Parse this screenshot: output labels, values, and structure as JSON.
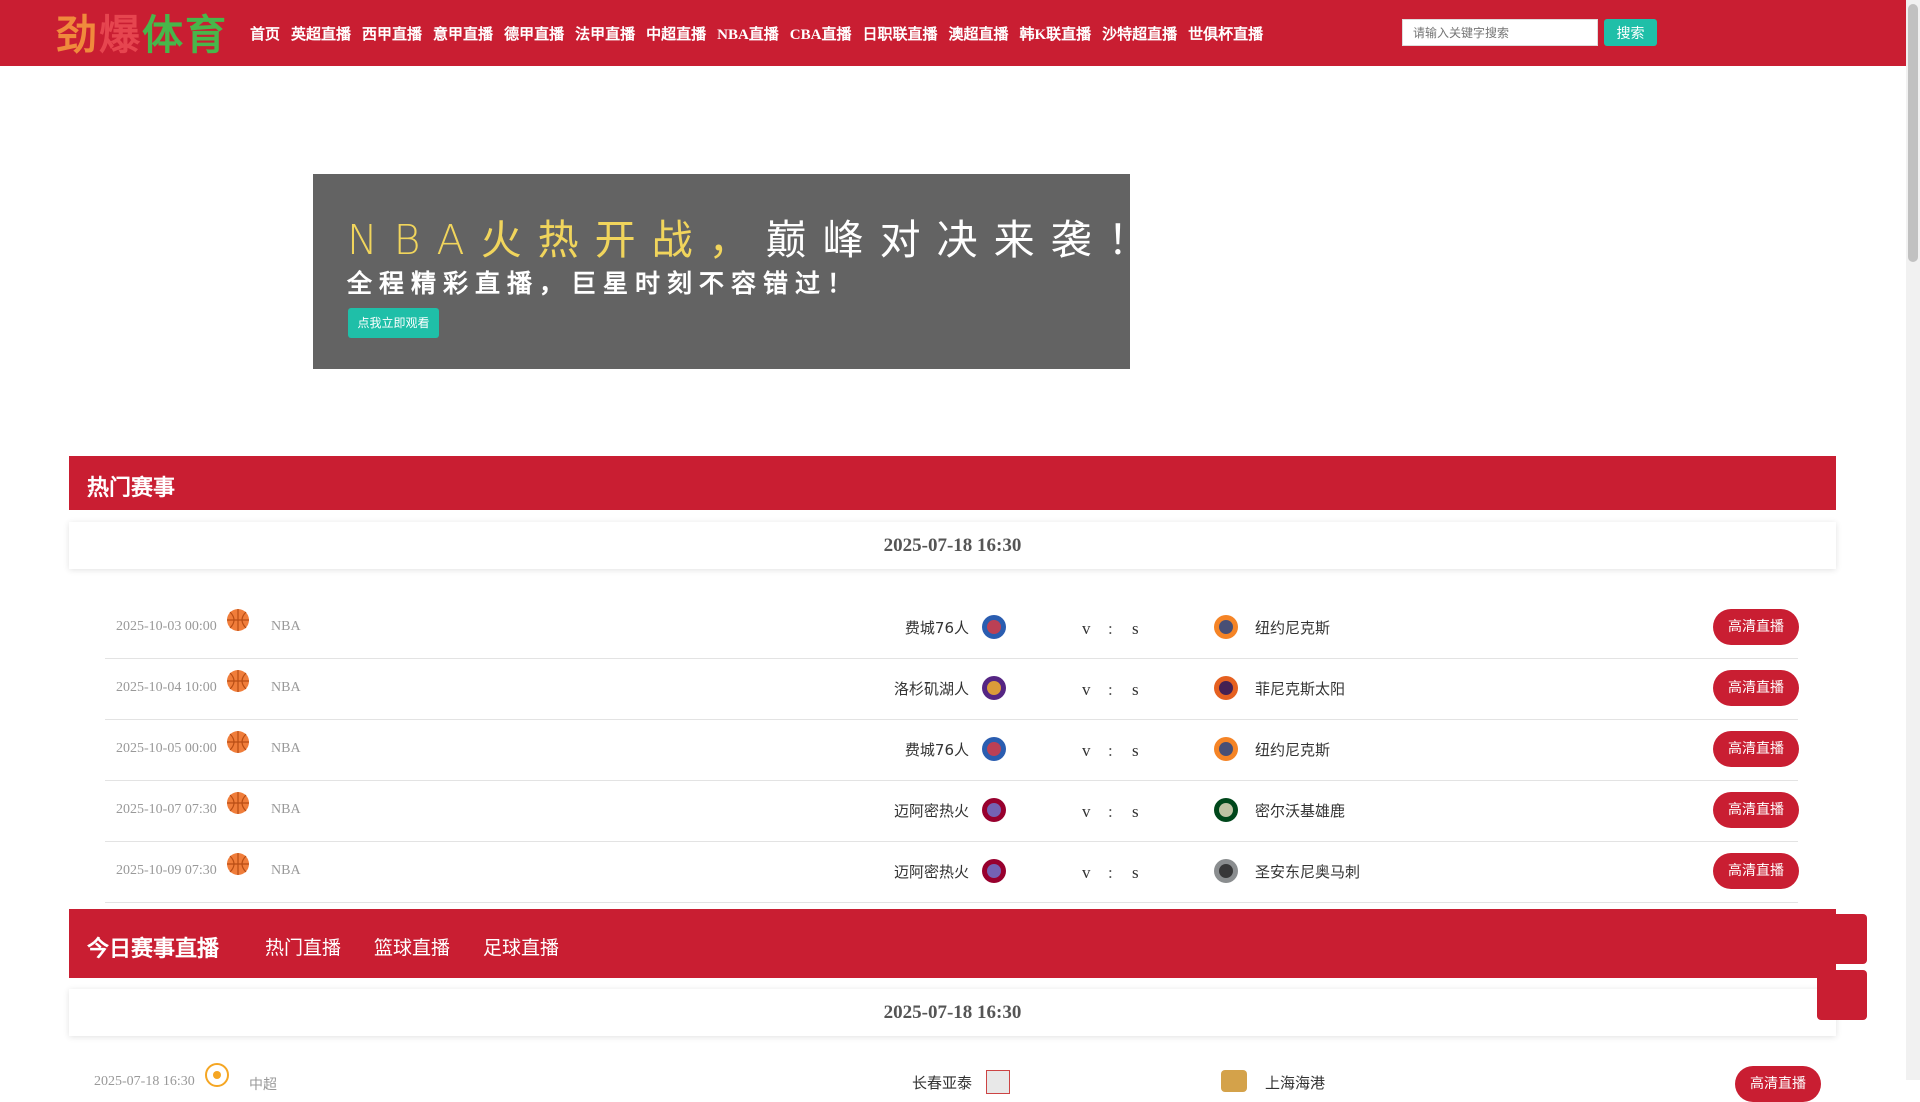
{
  "header": {
    "logo_text": "劲爆体育",
    "nav": [
      "首页",
      "英超直播",
      "西甲直播",
      "意甲直播",
      "德甲直播",
      "法甲直播",
      "中超直播",
      "NBA直播",
      "CBA直播",
      "日职联直播",
      "澳超直播",
      "韩K联直播",
      "沙特超直播",
      "世俱杯直播"
    ],
    "search_placeholder": "请输入关键字搜索",
    "search_button": "搜索"
  },
  "banner": {
    "title_highlight": "NBA火热开战，",
    "title_rest": "巅峰对决来袭！",
    "subtitle": "全程精彩直播，巨星时刻不容错过！",
    "button": "点我立即观看"
  },
  "hot": {
    "title": "热门赛事",
    "date": "2025-07-18 16:30",
    "matches": [
      {
        "time": "2025-10-03 00:00",
        "league": "NBA",
        "home": "费城76人",
        "away": "纽约尼克斯",
        "v": "v",
        "colon": ":",
        "s": "s",
        "button": "高清直播"
      },
      {
        "time": "2025-10-04 10:00",
        "league": "NBA",
        "home": "洛杉矶湖人",
        "away": "菲尼克斯太阳",
        "v": "v",
        "colon": ":",
        "s": "s",
        "button": "高清直播"
      },
      {
        "time": "2025-10-05 00:00",
        "league": "NBA",
        "home": "费城76人",
        "away": "纽约尼克斯",
        "v": "v",
        "colon": ":",
        "s": "s",
        "button": "高清直播"
      },
      {
        "time": "2025-10-07 07:30",
        "league": "NBA",
        "home": "迈阿密热火",
        "away": "密尔沃基雄鹿",
        "v": "v",
        "colon": ":",
        "s": "s",
        "button": "高清直播"
      },
      {
        "time": "2025-10-09 07:30",
        "league": "NBA",
        "home": "迈阿密热火",
        "away": "圣安东尼奥马刺",
        "v": "v",
        "colon": ":",
        "s": "s",
        "button": "高清直播"
      }
    ]
  },
  "today": {
    "title": "今日赛事直播",
    "tabs": [
      "热门直播",
      "篮球直播",
      "足球直播"
    ],
    "date": "2025-07-18 16:30",
    "partial": {
      "time": "2025-07-18 16:30",
      "league": "中超",
      "home": "长春亚泰",
      "away": "上海海港",
      "button": "高清直播"
    }
  },
  "colors": {
    "brand": "#c91e32",
    "accent": "#1fbfa8",
    "banner_bg": "#636363"
  }
}
